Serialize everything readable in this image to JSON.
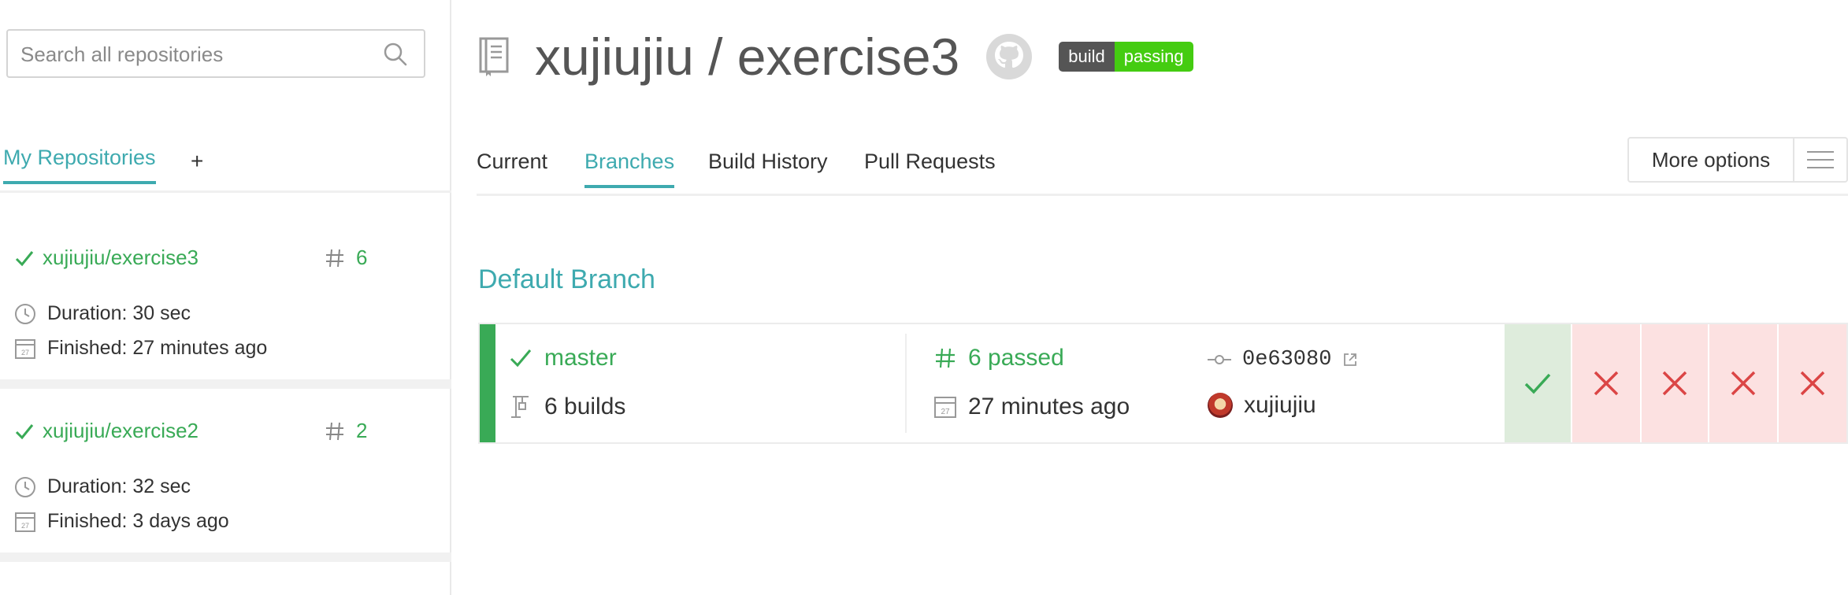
{
  "sidebar": {
    "search_placeholder": "Search all repositories",
    "tab_label": "My Repositories",
    "add_label": "+",
    "repos": [
      {
        "name": "xujiujiu/exercise3",
        "number": "6",
        "duration": "Duration: 30 sec",
        "finished": "Finished: 27 minutes ago",
        "status": "passed"
      },
      {
        "name": "xujiujiu/exercise2",
        "number": "2",
        "duration": "Duration: 32 sec",
        "finished": "Finished: 3 days ago",
        "status": "passed"
      }
    ]
  },
  "header": {
    "title": "xujiujiu / exercise3",
    "badge_left": "build",
    "badge_right": "passing"
  },
  "tabs": [
    "Current",
    "Branches",
    "Build History",
    "Pull Requests"
  ],
  "active_tab": "Branches",
  "more_options_label": "More options",
  "section_title": "Default Branch",
  "branch": {
    "name": "master",
    "builds": "6 builds",
    "passed": "6 passed",
    "time": "27 minutes ago",
    "commit": "0e63080",
    "author": "xujiujiu",
    "history": [
      "passed",
      "failed",
      "failed",
      "failed",
      "failed"
    ]
  },
  "colors": {
    "teal": "#3eaaaf",
    "green": "#39aa56",
    "red": "#db4545",
    "pass_bg": "#deecdc",
    "fail_bg": "#fce1e1"
  },
  "icons": {
    "search": "search-icon",
    "repo": "book-icon",
    "github": "github-icon",
    "check": "check-icon",
    "hash": "hash-icon",
    "clock": "clock-icon",
    "calendar": "calendar-icon",
    "commit": "commit-icon",
    "external": "external-link-icon",
    "builds": "builds-icon",
    "menu": "hamburger-icon",
    "cross": "cross-icon"
  }
}
